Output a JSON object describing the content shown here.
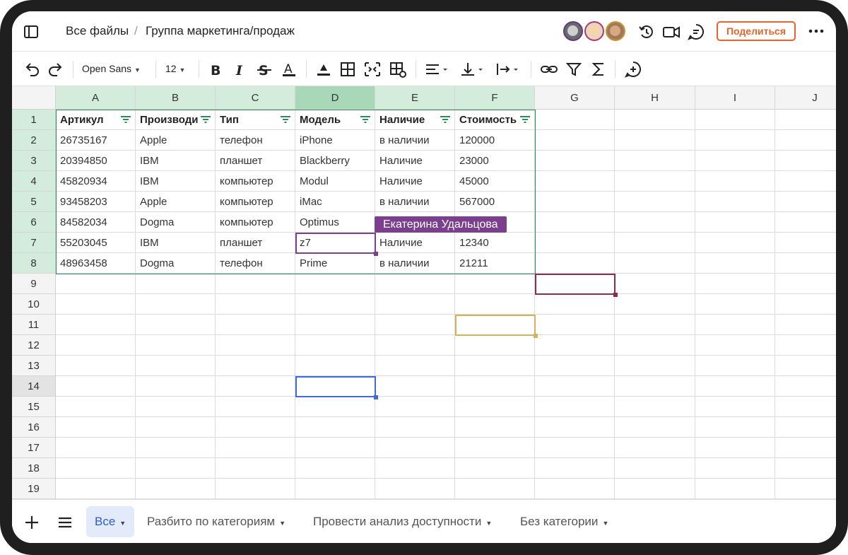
{
  "topbar": {
    "breadcrumb_root": "Все файлы",
    "breadcrumb_separator": "/",
    "breadcrumb_current": "Группа маркетинга/продаж",
    "share_label": "Поделиться",
    "share_color": "#e8642b"
  },
  "toolbar": {
    "font_family_value": "Open Sans",
    "font_size_value": "12"
  },
  "sheet": {
    "columns": [
      "A",
      "B",
      "C",
      "D",
      "E",
      "F",
      "G",
      "H",
      "I",
      "J"
    ],
    "rows": [
      "1",
      "2",
      "3",
      "4",
      "5",
      "6",
      "7",
      "8",
      "9",
      "10",
      "11",
      "12",
      "13",
      "14",
      "15",
      "16",
      "17",
      "18",
      "19"
    ],
    "header": [
      "Артикул",
      "Производитель",
      "Тип",
      "Модель",
      "Наличие",
      "Стоимость"
    ],
    "data": [
      [
        "26735167",
        "Apple",
        "телефон",
        "iPhone",
        "в наличии",
        "120000"
      ],
      [
        "20394850",
        "IBM",
        "планшет",
        "Blackberry",
        "Наличие",
        "23000"
      ],
      [
        "45820934",
        "IBM",
        "компьютер",
        "Modul",
        "Наличие",
        "45000"
      ],
      [
        "93458203",
        "Apple",
        "компьютер",
        "iMac",
        "в наличии",
        "567000"
      ],
      [
        "84582034",
        "Dogma",
        "компьютер",
        "Optimus",
        "",
        ""
      ],
      [
        "55203045",
        "IBM",
        "планшет",
        "z7",
        "Наличие",
        "12340"
      ],
      [
        "48963458",
        "Dogma",
        "телефон",
        "Prime",
        "в наличии",
        "21211"
      ]
    ],
    "collaborator_tag": "Екатерина Удальцова",
    "colors": {
      "selection_green": "#2e8b57",
      "collaborator_purple": "#7b3f8e",
      "collaborator_maroon": "#8e2c50",
      "collaborator_gold": "#d4b45a",
      "active_blue": "#3f6ad8"
    }
  },
  "bottombar": {
    "tabs": [
      {
        "label": "Все",
        "active": true
      },
      {
        "label": "Разбито по категориям",
        "active": false
      },
      {
        "label": "Провести анализ доступности",
        "active": false
      },
      {
        "label": "Без категории",
        "active": false
      }
    ]
  }
}
